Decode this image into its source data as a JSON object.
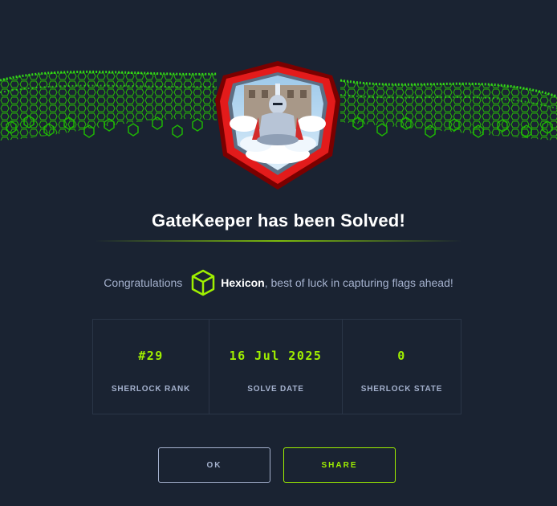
{
  "modal": {
    "title": "GateKeeper has been Solved!",
    "congrats_prefix": "Congratulations",
    "username": "Hexicon",
    "congrats_suffix": ", best of luck in capturing flags ahead!"
  },
  "stats": [
    {
      "value": "#29",
      "label": "SHERLOCK RANK"
    },
    {
      "value": "16 Jul 2025",
      "label": "SOLVE DATE"
    },
    {
      "value": "0",
      "label": "SHERLOCK STATE"
    }
  ],
  "buttons": {
    "ok_label": "OK",
    "share_label": "SHARE"
  },
  "icons": {
    "banner": "green-hex-grid-wave",
    "badge": "red-shield-knight-badge",
    "user": "green-cube-icon"
  },
  "colors": {
    "background": "#1a2332",
    "accent": "#9fef00",
    "muted_text": "#a4b1cd",
    "badge_red": "#e31b1b"
  }
}
